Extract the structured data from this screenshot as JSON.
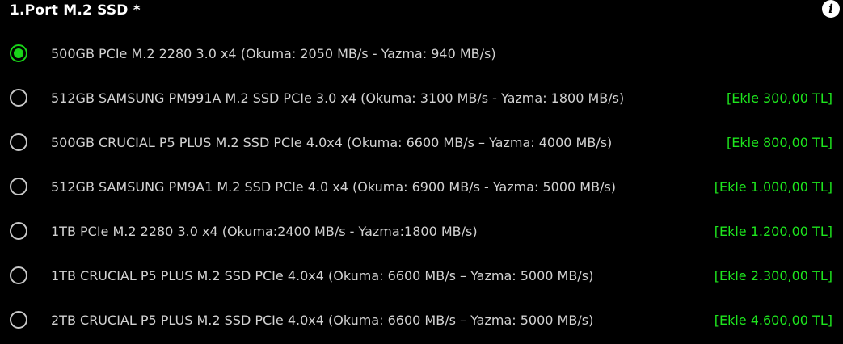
{
  "header": {
    "title": "1.Port M.2 SSD *",
    "info_icon": "i"
  },
  "options": [
    {
      "label": "500GB PCIe M.2 2280 3.0 x4 (Okuma: 2050 MB/s - Yazma: 940 MB/s)",
      "price": "",
      "selected": true
    },
    {
      "label": "512GB SAMSUNG PM991A M.2 SSD PCIe 3.0 x4 (Okuma: 3100 MB/s - Yazma: 1800 MB/s)",
      "price": "[Ekle 300,00 TL]",
      "selected": false
    },
    {
      "label": "500GB CRUCIAL P5 PLUS M.2 SSD PCIe 4.0x4 (Okuma: 6600 MB/s – Yazma: 4000 MB/s)",
      "price": "[Ekle 800,00 TL]",
      "selected": false
    },
    {
      "label": "512GB SAMSUNG PM9A1 M.2 SSD PCIe 4.0 x4 (Okuma: 6900 MB/s - Yazma: 5000 MB/s)",
      "price": "[Ekle 1.000,00 TL]",
      "selected": false
    },
    {
      "label": "1TB PCIe M.2 2280 3.0 x4 (Okuma:2400 MB/s - Yazma:1800 MB/s)",
      "price": "[Ekle 1.200,00 TL]",
      "selected": false
    },
    {
      "label": "1TB CRUCIAL P5 PLUS M.2 SSD PCIe 4.0x4 (Okuma: 6600 MB/s – Yazma: 5000 MB/s)",
      "price": "[Ekle 2.300,00 TL]",
      "selected": false
    },
    {
      "label": "2TB CRUCIAL P5 PLUS M.2 SSD PCIe 4.0x4 (Okuma: 6600 MB/s – Yazma: 5000 MB/s)",
      "price": "[Ekle 4.600,00 TL]",
      "selected": false
    }
  ],
  "colors": {
    "background": "#000000",
    "accent_selected": "#19d419",
    "price": "#1ee61e",
    "text": "#d2d2d2"
  }
}
